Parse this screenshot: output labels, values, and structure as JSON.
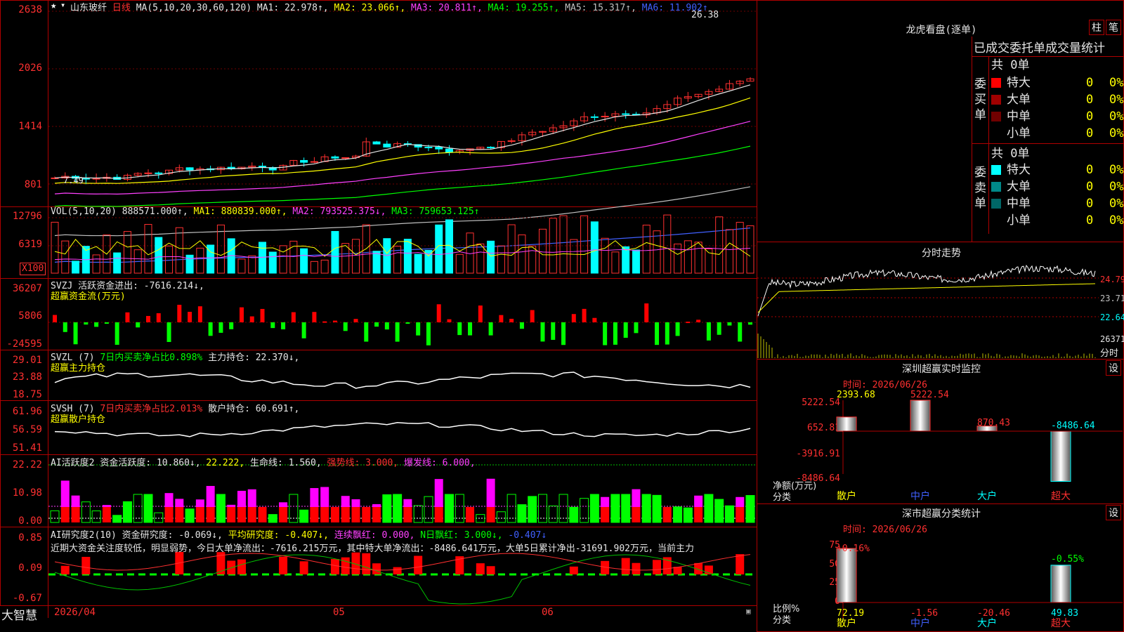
{
  "stock": {
    "name": "山东玻纤",
    "period": "日线"
  },
  "colors": {
    "up": "#ff3030",
    "down": "#00ffff",
    "ma1": "#e6e6e6",
    "ma2": "#ffff00",
    "ma3": "#ff40ff",
    "ma4": "#00ff00",
    "ma5": "#c0c0c0",
    "ma6": "#4060ff"
  },
  "price_panel": {
    "legend": {
      "ma_params": "MA(5,10,20,30,60,120)",
      "ma1": "MA1: 22.978↑,",
      "ma2": "MA2: 23.066↑,",
      "ma3": "MA3: 20.811↑,",
      "ma4": "MA4: 19.255↑,",
      "ma5": "MA5: 15.317↑,",
      "ma6": "MA6: 11.902↑"
    },
    "y_labels": [
      "2638",
      "2026",
      "1414",
      "801"
    ],
    "high_marker": "26.38",
    "low_marker": "7.49"
  },
  "vol_panel": {
    "legend": {
      "name": "VOL(5,10,20)",
      "value": "888571.000↑,",
      "ma1": "MA1: 880839.000↑,",
      "ma2": "MA2: 793525.375↓,",
      "ma3": "MA3: 759653.125↑"
    },
    "y_labels": [
      "12796",
      "6319"
    ],
    "unit": "X100"
  },
  "svzj_panel": {
    "legend": {
      "name": "SVZJ",
      "label": "活跃资金进出: -7616.214↓,",
      "sub": "超赢资金流(万元)"
    },
    "y_labels": [
      "36207",
      "5806",
      "-24595"
    ]
  },
  "svzl_panel": {
    "legend": {
      "name": "SVZL",
      "param": "(7)",
      "ratio": "7日内买卖净占比0.898%",
      "hold": "主力持仓: 22.370↓,",
      "sub": "超赢主力持仓"
    },
    "y_labels": [
      "29.01",
      "23.88",
      "18.75"
    ]
  },
  "svsh_panel": {
    "legend": {
      "name": "SVSH",
      "param": "(7)",
      "ratio": "7日内买卖净占比2.013%",
      "hold": "散户持仓: 60.691↑,",
      "sub": "超赢散户持仓"
    },
    "y_labels": [
      "61.96",
      "56.59",
      "51.41"
    ]
  },
  "ai_active_panel": {
    "legend": {
      "name": "AI活跃度2",
      "act": "资金活跃度: 10.860↓,",
      "v2": "22.222,",
      "life": "生命线: 1.560,",
      "strong": "强势线: 3.000,",
      "burst": "爆发线: 6.000,"
    },
    "y_labels": [
      "22.22",
      "10.98",
      "0.00"
    ]
  },
  "ai_research_panel": {
    "legend": {
      "name": "AI研究度2(10)",
      "res": "资金研究度: -0.069↓,",
      "avg": "平均研究度: -0.407↓,",
      "cont": "连续飘红: 0.000,",
      "nday": "N日飘红: 3.000↓,",
      "v5": "-0.407↓"
    },
    "comment": "近期大资金关注度较低，明显弱势，今日大单净流出：-7616.215万元，其中特大单净流出：-8486.641万元，大单5日累计净出-31691.902万元，当前主力",
    "y_labels": [
      "0.85",
      "0.09",
      "-0.67"
    ]
  },
  "x_axis": {
    "labels": [
      "2026/04",
      "05",
      "06"
    ]
  },
  "brand": "大智慧",
  "right": {
    "lhb": {
      "title": "龙虎看盘(逐单)",
      "btn1": "柱",
      "btn2": "笔",
      "header": "已成交委托单成交量统计",
      "buy": {
        "side": "委买单",
        "total": "共 0单",
        "rows": [
          {
            "name": "特大",
            "value": "0",
            "pct": "0%",
            "color": "#ff0000"
          },
          {
            "name": "大单",
            "value": "0",
            "pct": "0%",
            "color": "#a00000"
          },
          {
            "name": "中单",
            "value": "0",
            "pct": "0%",
            "color": "#700000"
          },
          {
            "name": "小单",
            "value": "0",
            "pct": "0%",
            "color": "#000000"
          }
        ]
      },
      "sell": {
        "side": "委卖单",
        "total": "共 0单",
        "rows": [
          {
            "name": "特大",
            "value": "0",
            "pct": "0%",
            "color": "#00ffff"
          },
          {
            "name": "大单",
            "value": "0",
            "pct": "0%",
            "color": "#008888"
          },
          {
            "name": "中单",
            "value": "0",
            "pct": "0%",
            "color": "#006666"
          },
          {
            "name": "小单",
            "value": "0",
            "pct": "0%",
            "color": "#000000"
          }
        ]
      }
    },
    "intraday": {
      "title": "分时走势",
      "y_labels": [
        "24.79",
        "23.71",
        "22.64"
      ],
      "vol_label": "26371",
      "vol_unit": "分时"
    },
    "sz_monitor": {
      "title": "深圳超赢实时监控",
      "btn": "设",
      "time": "时间: 2026/06/26",
      "y_labels": [
        "5222.54",
        "652.81",
        "-3916.91",
        "-8486.64"
      ],
      "axis_label": "净额(万元)",
      "axis_sub": "分类",
      "chart_data": {
        "type": "bar",
        "categories": [
          "散户",
          "中户",
          "大户",
          "超大"
        ],
        "values": [
          2393.68,
          5222.54,
          870.43,
          -8486.64
        ],
        "value_labels": [
          "2393.68",
          "5222.54",
          "870.43",
          "-8486.64"
        ],
        "ylim": [
          -8486.64,
          5222.54
        ]
      }
    },
    "sz_category": {
      "title": "深市超赢分类统计",
      "btn": "设",
      "time": "时间: 2026/06/26",
      "y_labels": [
        "75",
        "50",
        "25",
        "0"
      ],
      "axis_label": "比例%",
      "axis_sub": "分类",
      "chart_data": {
        "type": "bar",
        "categories": [
          "散户",
          "中户",
          "大户",
          "超大"
        ],
        "values": [
          72.19,
          -1.56,
          -20.46,
          49.83
        ],
        "value_labels": [
          "72.19",
          "-1.56",
          "-20.46",
          "49.83"
        ],
        "top_labels": [
          "+0.16%",
          "",
          "",
          "-0.55%"
        ],
        "ylim": [
          0,
          75
        ]
      }
    }
  }
}
